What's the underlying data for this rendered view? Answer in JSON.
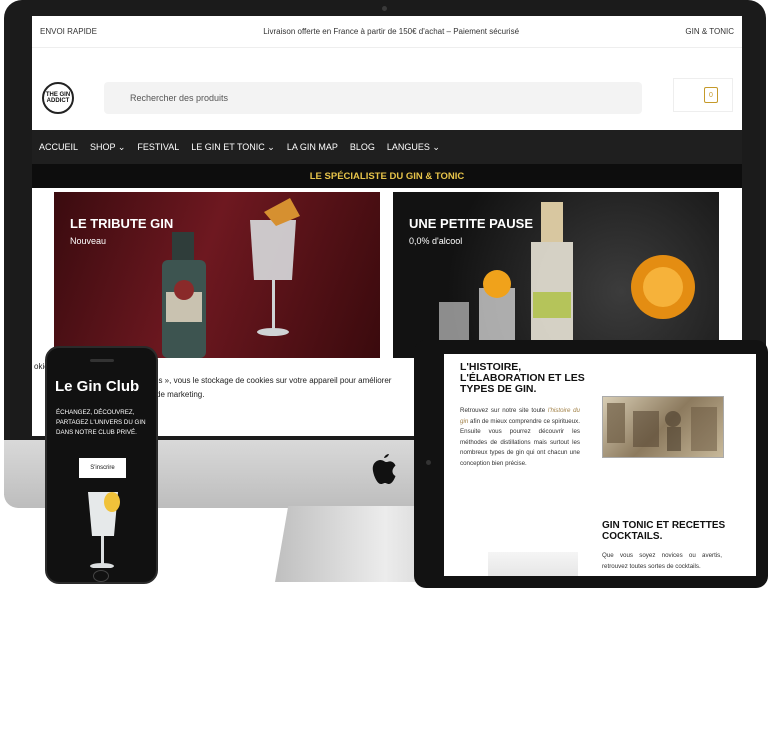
{
  "desktop": {
    "topbar": {
      "left": "ENVOI RAPIDE",
      "center": "Livraison offerte en France à partir de 150€ d'achat –  Paiement sécurisé",
      "right": "GIN & TONIC"
    },
    "logo_text": "THE GIN ADDICT",
    "search_placeholder": "Rechercher des produits",
    "cart_count": "0",
    "nav": [
      "ACCUEIL",
      "SHOP ⌄",
      "FESTIVAL",
      "LE GIN ET TONIC ⌄",
      "LA GIN MAP",
      "BLOG",
      "LANGUES ⌄"
    ],
    "banner": "LE SPÉCIALISTE DU GIN & TONIC",
    "heroes": [
      {
        "title": "LE TRIBUTE GIN",
        "subtitle": "Nouveau"
      },
      {
        "title": "UNE PETITE PAUSE",
        "subtitle": "0,0% d'alcool"
      }
    ],
    "cookie_lines": [
      "okie",
      "es », vous le stockage de cookies sur votre appareil pour améliorer",
      "de marketing."
    ]
  },
  "phone": {
    "title": "Le Gin Club",
    "description": "ÉCHANGEZ, DÉCOUVREZ, PARTAGEZ L'UNIVERS DU GIN DANS NOTRE CLUB PRIVÉ.",
    "button": "S'inscrire"
  },
  "tablet": {
    "title1": "L'HISTOIRE, L'ÉLABORATION ET LES TYPES DE GIN.",
    "text1_before": "Retrouvez sur notre site toute ",
    "text1_link": "l'histoire du gin",
    "text1_after": " afin de mieux comprendre ce spiritueux. Ensuite vous pourrez découvrir les méthodes de distillations mais surtout les nombreux types de gin qui ont chacun une conception bien précise.",
    "title2": "GIN TONIC ET RECETTES COCKTAILS.",
    "text2": "Que vous soyez novices ou avertis, retrouvez toutes sortes de cocktails."
  },
  "colors": {
    "accent_gold": "#e7c44a",
    "nav_bg": "#1f1f1f",
    "hero_red": "#6e1820"
  }
}
